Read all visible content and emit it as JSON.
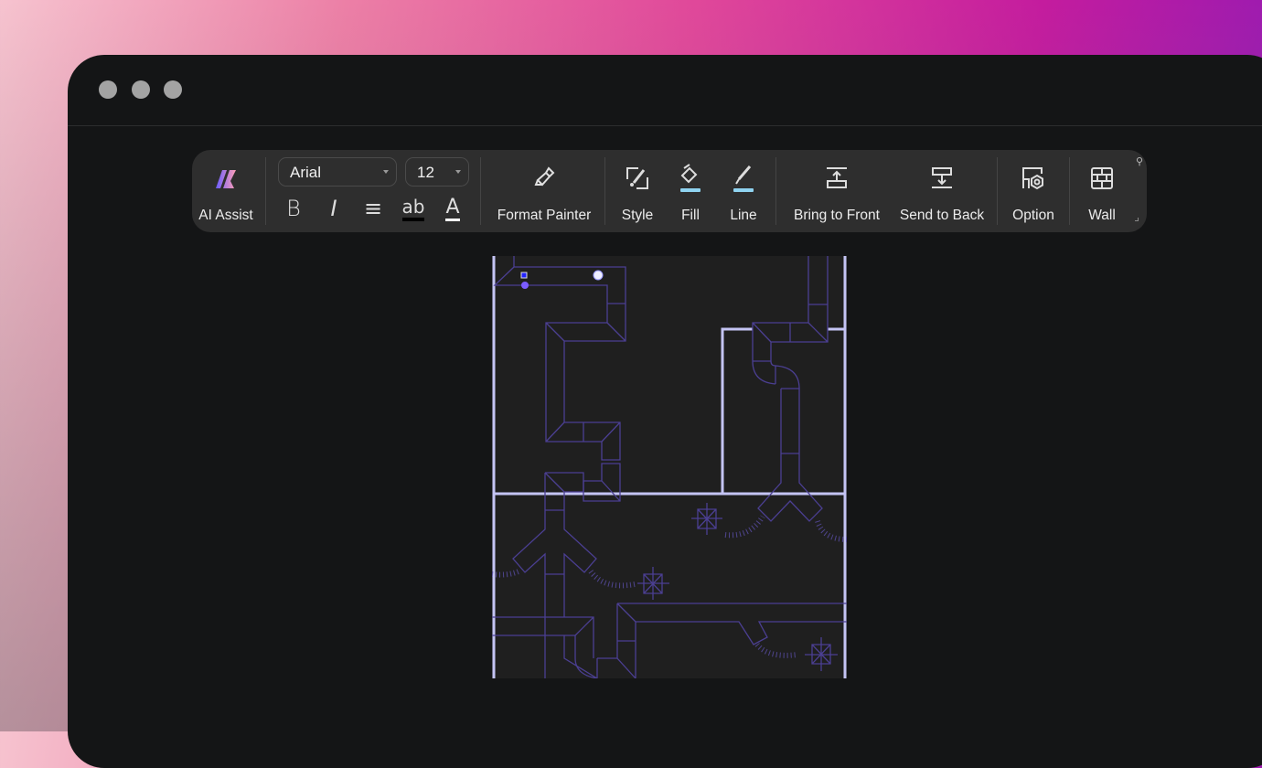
{
  "window": {
    "controls": [
      "close",
      "minimize",
      "maximize"
    ]
  },
  "toolbar": {
    "ai_assist": "AI Assist",
    "font_family": "Arial",
    "font_size": "12",
    "format_buttons": [
      {
        "name": "bold",
        "glyph": "B"
      },
      {
        "name": "italic",
        "glyph": "I"
      },
      {
        "name": "align",
        "glyph": "≡"
      },
      {
        "name": "highlight",
        "glyph": "ab"
      },
      {
        "name": "font-color",
        "glyph": "A"
      }
    ],
    "format_painter": "Format Painter",
    "style": "Style",
    "fill": "Fill",
    "line": "Line",
    "bring_to_front": "Bring to Front",
    "send_to_back": "Send to Back",
    "option": "Option",
    "wall": "Wall",
    "accent_fill": "#8fd3f0",
    "accent_line": "#8fd3f0"
  },
  "canvas": {
    "wall_color": "#c4c4f4",
    "duct_color": "#4b3f92",
    "background": "#1f1f1f"
  }
}
